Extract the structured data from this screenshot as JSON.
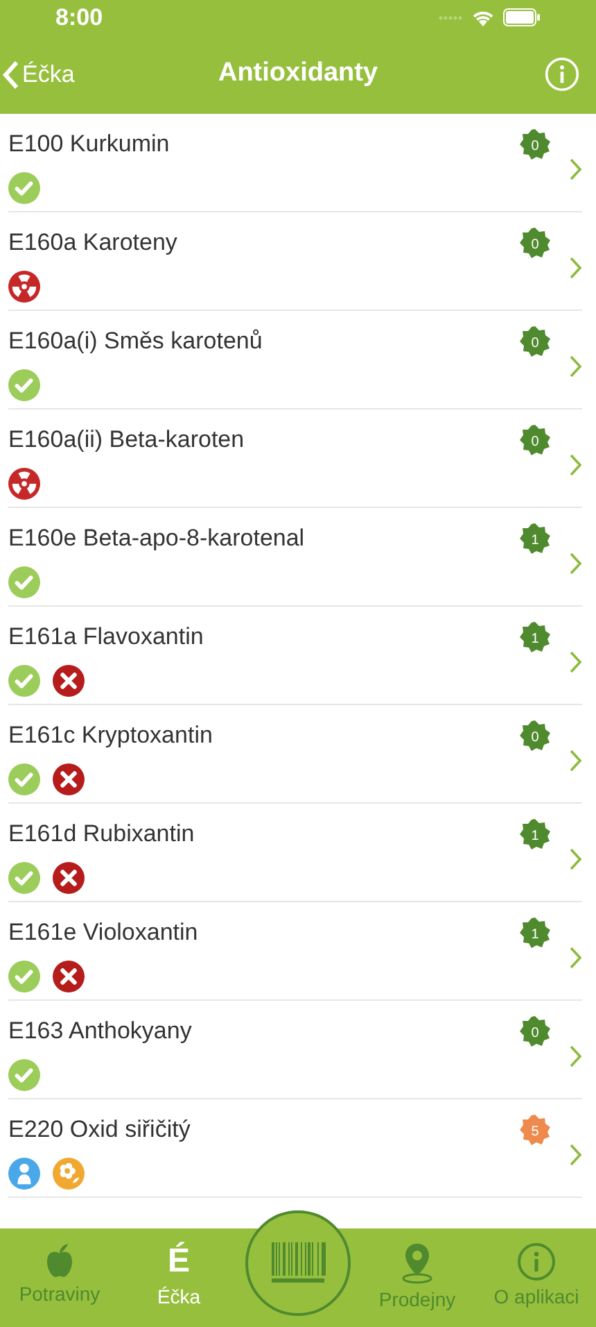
{
  "status_bar": {
    "time": "8:00"
  },
  "nav": {
    "back": "Éčka",
    "title": "Antioxidanty"
  },
  "items": [
    {
      "name": "E100 Kurkumin",
      "count": "0",
      "color": "#4f8a2e",
      "icons": [
        {
          "kind": "ok"
        }
      ]
    },
    {
      "name": "E160a Karoteny",
      "count": "0",
      "color": "#4f8a2e",
      "icons": [
        {
          "kind": "radiation"
        }
      ]
    },
    {
      "name": "E160a(i) Směs karotenů",
      "count": "0",
      "color": "#4f8a2e",
      "icons": [
        {
          "kind": "ok"
        }
      ]
    },
    {
      "name": "E160a(ii) Beta-karoten",
      "count": "0",
      "color": "#4f8a2e",
      "icons": [
        {
          "kind": "radiation"
        }
      ]
    },
    {
      "name": "E160e Beta-apo-8-karotenal",
      "count": "1",
      "color": "#4f8a2e",
      "icons": [
        {
          "kind": "ok"
        }
      ]
    },
    {
      "name": "E161a Flavoxantin",
      "count": "1",
      "color": "#4f8a2e",
      "icons": [
        {
          "kind": "ok"
        },
        {
          "kind": "forbidden"
        }
      ]
    },
    {
      "name": "E161c Kryptoxantin",
      "count": "0",
      "color": "#4f8a2e",
      "icons": [
        {
          "kind": "ok"
        },
        {
          "kind": "forbidden"
        }
      ]
    },
    {
      "name": "E161d Rubixantin",
      "count": "1",
      "color": "#4f8a2e",
      "icons": [
        {
          "kind": "ok"
        },
        {
          "kind": "forbidden"
        }
      ]
    },
    {
      "name": "E161e Violoxantin",
      "count": "1",
      "color": "#4f8a2e",
      "icons": [
        {
          "kind": "ok"
        },
        {
          "kind": "forbidden"
        }
      ]
    },
    {
      "name": "E163 Anthokyany",
      "count": "0",
      "color": "#4f8a2e",
      "icons": [
        {
          "kind": "ok"
        }
      ]
    },
    {
      "name": "E220 Oxid siřičitý",
      "count": "5",
      "color": "#ee8a4e",
      "icons": [
        {
          "kind": "baby"
        },
        {
          "kind": "allergy"
        }
      ]
    }
  ],
  "tab_bar": [
    {
      "kind": "apple",
      "label": "Potraviny",
      "selected": false
    },
    {
      "kind": "glyph",
      "glyph": "É",
      "label": "Éčka",
      "selected": true
    },
    {
      "kind": "scan"
    },
    {
      "kind": "pin",
      "label": "Prodejny",
      "selected": false
    },
    {
      "kind": "info",
      "label": "O aplikaci",
      "selected": false
    }
  ]
}
